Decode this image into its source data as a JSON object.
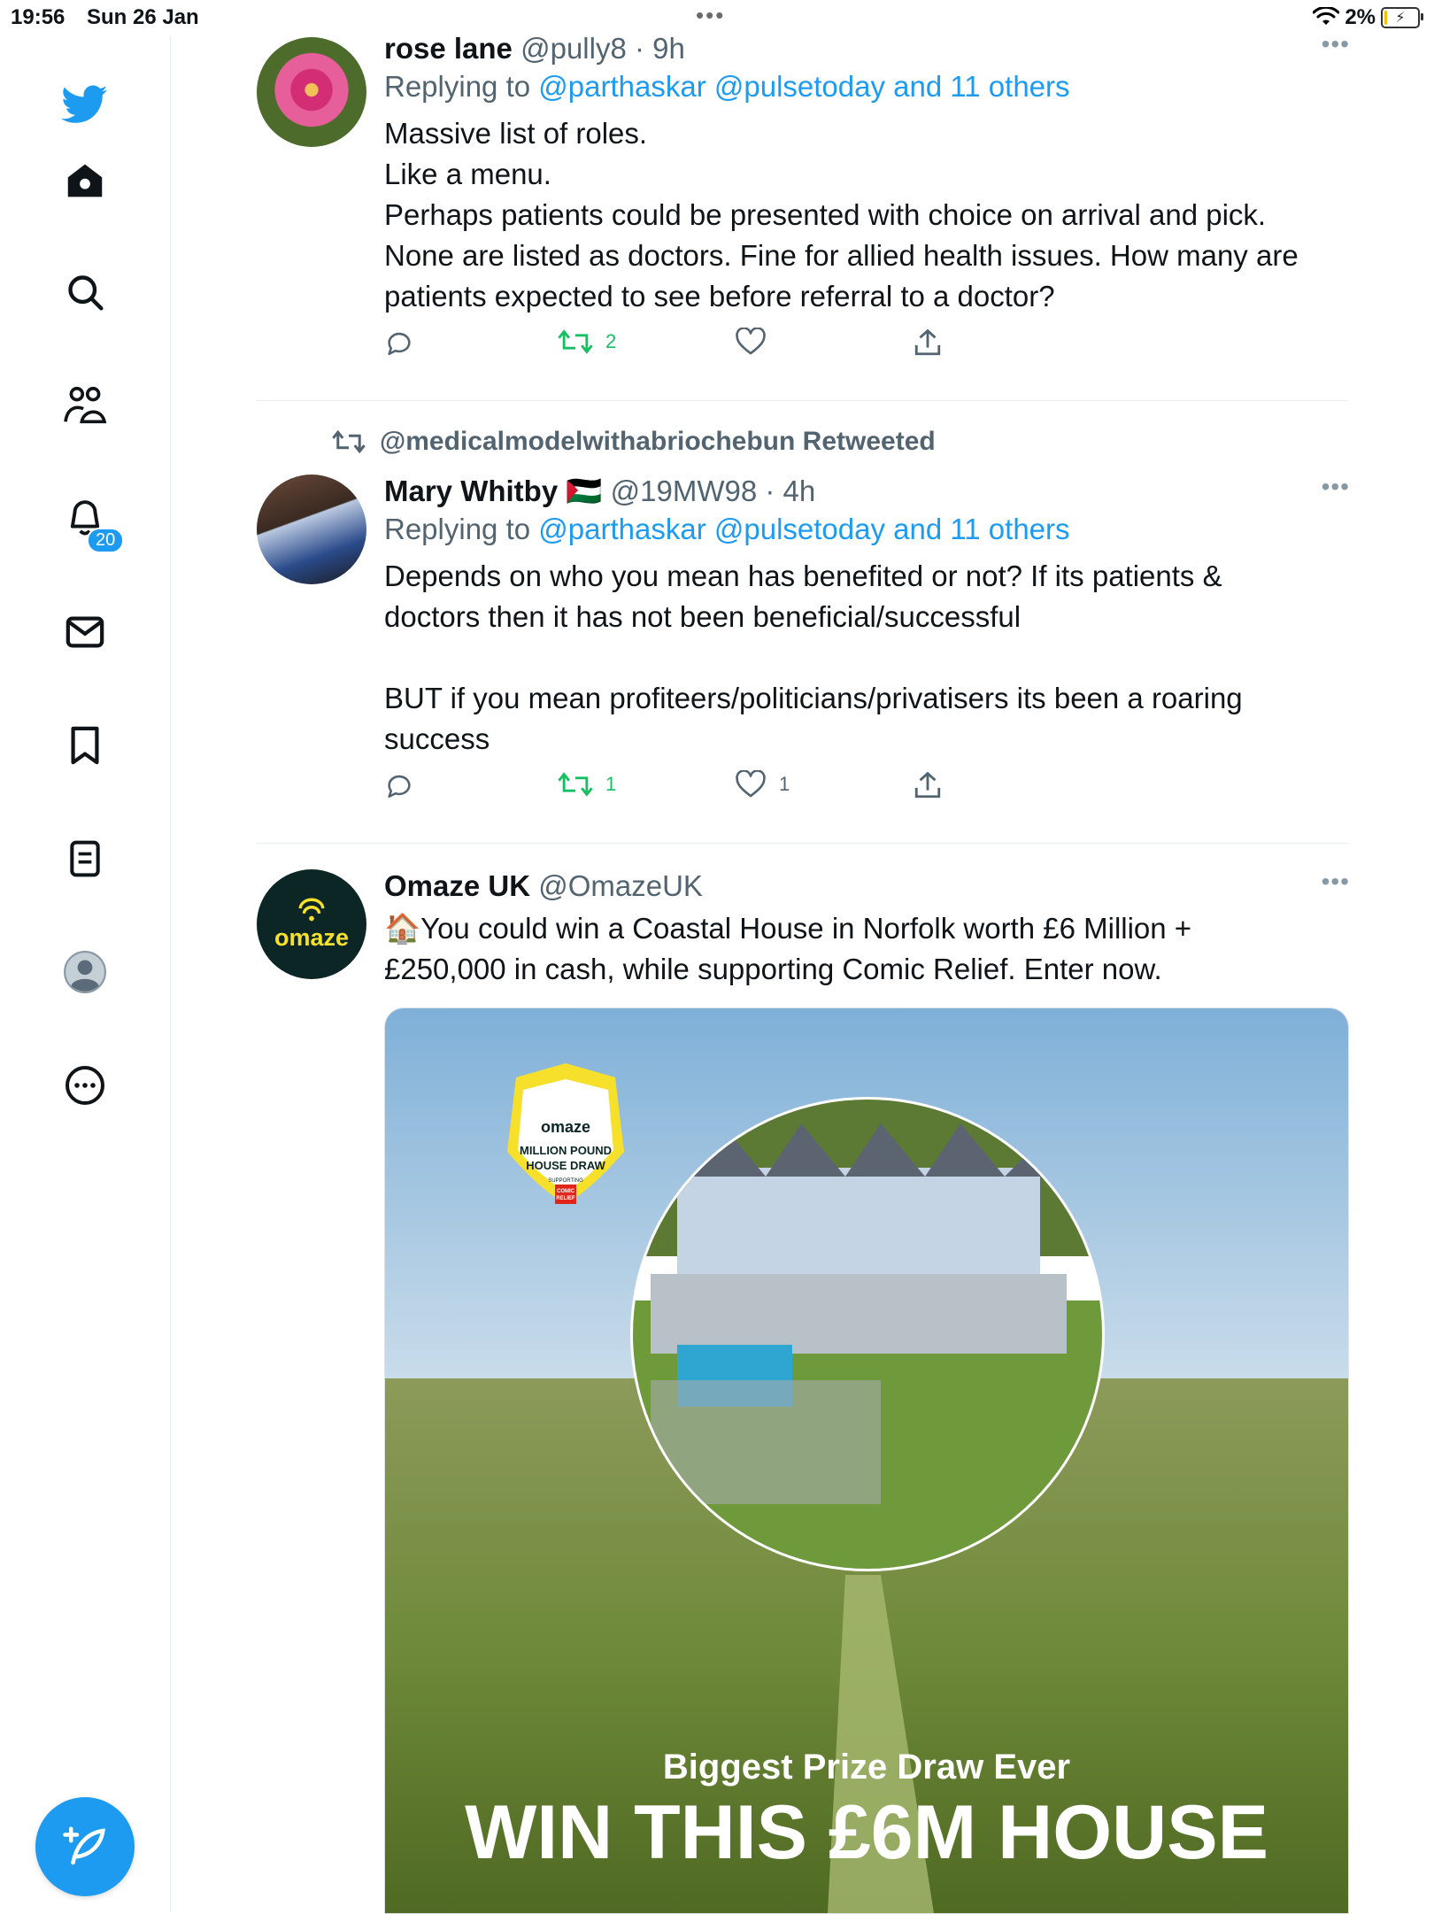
{
  "status": {
    "time": "19:56",
    "date": "Sun 26 Jan",
    "battery": "2%"
  },
  "sidebar": {
    "items": [
      {
        "icon": "twitter-bird-icon"
      },
      {
        "icon": "home-icon"
      },
      {
        "icon": "search-icon"
      },
      {
        "icon": "communities-icon"
      },
      {
        "icon": "notifications-icon",
        "badge": "20"
      },
      {
        "icon": "messages-icon"
      },
      {
        "icon": "bookmarks-icon"
      },
      {
        "icon": "lists-icon"
      },
      {
        "icon": "profile-icon"
      },
      {
        "icon": "more-icon"
      }
    ],
    "compose_icon": "compose-icon"
  },
  "tweets": [
    {
      "name": "rose lane",
      "handle": "@pully8",
      "sep": "·",
      "time": "9h",
      "replying_prefix": "Replying to",
      "replying_to": "@parthaskar @pulsetoday and 11 others",
      "text_lines": [
        "Massive list of roles.",
        "Like a menu.",
        "Perhaps patients could be presented with choice on arrival and pick.",
        "None are listed as doctors. Fine for allied health issues. How many are",
        "patients expected to see before referral to a doctor?"
      ],
      "retweets": "2",
      "likes": ""
    },
    {
      "retweeted_by": "@medicalmodelwithabriochebun Retweeted",
      "name": "Mary Whitby",
      "flag": "🇵🇸",
      "handle": "@19MW98",
      "sep": "·",
      "time": "4h",
      "replying_prefix": "Replying to",
      "replying_to": "@parthaskar @pulsetoday and 11 others",
      "text_lines": [
        "Depends on who you mean has benefited or not? If its patients &",
        "doctors then it has not been beneficial/successful",
        "",
        "BUT if you mean profiteers/politicians/privatisers its been a roaring",
        "success"
      ],
      "retweets": "1",
      "likes": "1"
    },
    {
      "name": "Omaze UK",
      "handle": "@OmazeUK",
      "avatar_text": "omaze",
      "emoji": "🏠",
      "text_lines": [
        "You could win a Coastal House in Norfolk worth £6 Million +",
        "£250,000 in cash, while supporting Comic Relief. Enter now."
      ]
    }
  ],
  "ad": {
    "badge_brand": "omaze",
    "badge_title_1": "MILLION POUND",
    "badge_title_2": "HOUSE DRAW",
    "badge_supporting": "SUPPORTING",
    "charity_1": "COMIC",
    "charity_2": "RELIEF",
    "headline": "Biggest Prize Draw Ever",
    "big_text": "WIN THIS £6M HOUSE"
  },
  "colors": {
    "twitter_blue": "#1d9bf0",
    "retweet_green": "#17bf63",
    "muted_text": "#536471",
    "omaze_yellow": "#f7e02c"
  }
}
